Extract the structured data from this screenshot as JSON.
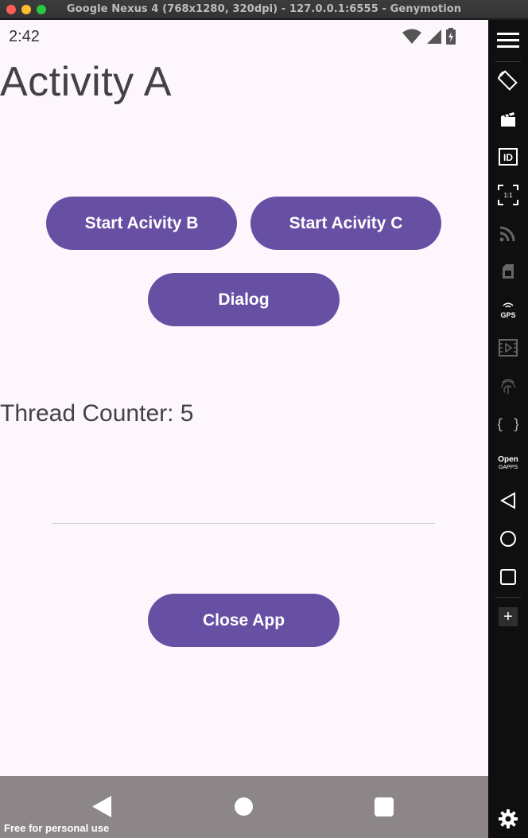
{
  "window": {
    "title": "Google Nexus 4 (768x1280, 320dpi) - 127.0.0.1:6555 - Genymotion"
  },
  "status_bar": {
    "time": "2:42",
    "icons": [
      "wifi-icon",
      "signal-icon",
      "battery-icon"
    ]
  },
  "activity": {
    "title": "Activity A",
    "buttons": {
      "start_b": "Start Acivity B",
      "start_c": "Start Acivity C",
      "dialog": "Dialog",
      "close": "Close App"
    },
    "thread_counter": "Thread Counter: 5"
  },
  "nav_bar": {
    "icons": [
      "back-icon",
      "home-icon",
      "recents-icon"
    ],
    "watermark": "Free for personal use"
  },
  "sidebar": {
    "tools": [
      {
        "icon": "menu-icon"
      },
      {
        "icon": "rotate-icon"
      },
      {
        "icon": "capture-icon"
      },
      {
        "icon": "id-icon"
      },
      {
        "icon": "pixel-perfect-icon",
        "label": "1:1"
      },
      {
        "icon": "cast-icon"
      },
      {
        "icon": "sim-icon"
      },
      {
        "icon": "gps-icon",
        "label": "GPS"
      },
      {
        "icon": "media-icon"
      },
      {
        "icon": "fingerprint-icon"
      },
      {
        "icon": "braces-icon",
        "label": "{ }"
      },
      {
        "icon": "opengapps-icon",
        "label": "Open",
        "sublabel": "GAPPS"
      },
      {
        "icon": "back-icon"
      },
      {
        "icon": "home-icon"
      },
      {
        "icon": "recents-icon"
      },
      {
        "icon": "plus-icon",
        "label": "+"
      },
      {
        "icon": "settings-icon"
      }
    ]
  },
  "colors": {
    "primary": "#6750a4",
    "background": "#fdf7fd",
    "nav_bar": "#8d8689",
    "sidebar": "#0f0f0f"
  }
}
